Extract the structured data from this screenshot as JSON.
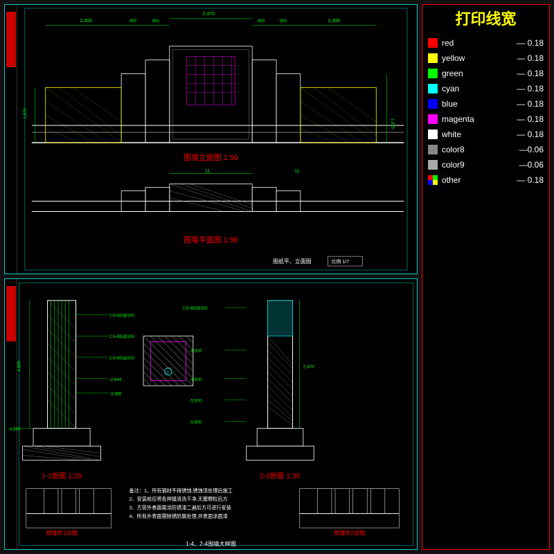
{
  "legend": {
    "title": "打印线宽",
    "items": [
      {
        "id": "red",
        "label": "red",
        "value": "0.18",
        "color": "#ff0000",
        "separator": "—"
      },
      {
        "id": "yellow",
        "label": "yellow",
        "value": "0.18",
        "color": "#ffff00",
        "separator": "—"
      },
      {
        "id": "green",
        "label": "green",
        "value": "0.18",
        "color": "#00ff00",
        "separator": "—"
      },
      {
        "id": "cyan",
        "label": "cyan",
        "value": "0.18",
        "color": "#00ffff",
        "separator": "—"
      },
      {
        "id": "blue",
        "label": "blue",
        "value": "0.18",
        "color": "#0000ff",
        "separator": "—"
      },
      {
        "id": "magenta",
        "label": "magenta",
        "value": "0.18",
        "color": "#ff00ff",
        "separator": "—"
      },
      {
        "id": "white",
        "label": "white",
        "value": "0.18",
        "color": "#ffffff",
        "separator": "—"
      },
      {
        "id": "color8",
        "label": "color8",
        "value": "0.06",
        "color": "#888888",
        "separator": "—"
      },
      {
        "id": "color9",
        "label": "color9",
        "value": "0.06",
        "color": "#aaaaaa",
        "separator": "—"
      },
      {
        "id": "other",
        "label": "other",
        "value": "0.18",
        "color": "multi",
        "separator": "—"
      }
    ]
  },
  "top_drawing": {
    "label1": "围墙立面图 1:90",
    "label2": "围墙平面图 1:90",
    "footer": "图纸平、立面图   比例: 1/7"
  },
  "bottom_drawing": {
    "label1": "1-1剖面  1:20",
    "label2": "2-2剖面  1:30",
    "label3": "预埋件1详图",
    "label4": "预埋件2详图",
    "footer": "1-4、2-4围墙大样图"
  }
}
